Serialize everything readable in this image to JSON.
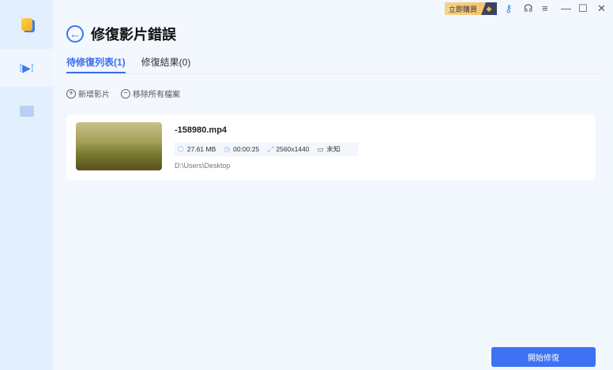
{
  "topbar": {
    "buy_label": "立即購買"
  },
  "page": {
    "title": "修復影片錯誤"
  },
  "tabs": [
    {
      "label": "待修復列表(1)"
    },
    {
      "label": "修復結果(0)"
    }
  ],
  "actions": {
    "add": "新增影片",
    "remove_all": "移除所有檔案"
  },
  "file": {
    "name": "-158980.mp4",
    "size": "27.61 MB",
    "duration": "00:00:25",
    "resolution": "2560x1440",
    "codec": "未知",
    "path": "D:\\Users\\Desktop"
  },
  "start_button": "開始修復",
  "colors": {
    "accent": "#3d72f2"
  }
}
